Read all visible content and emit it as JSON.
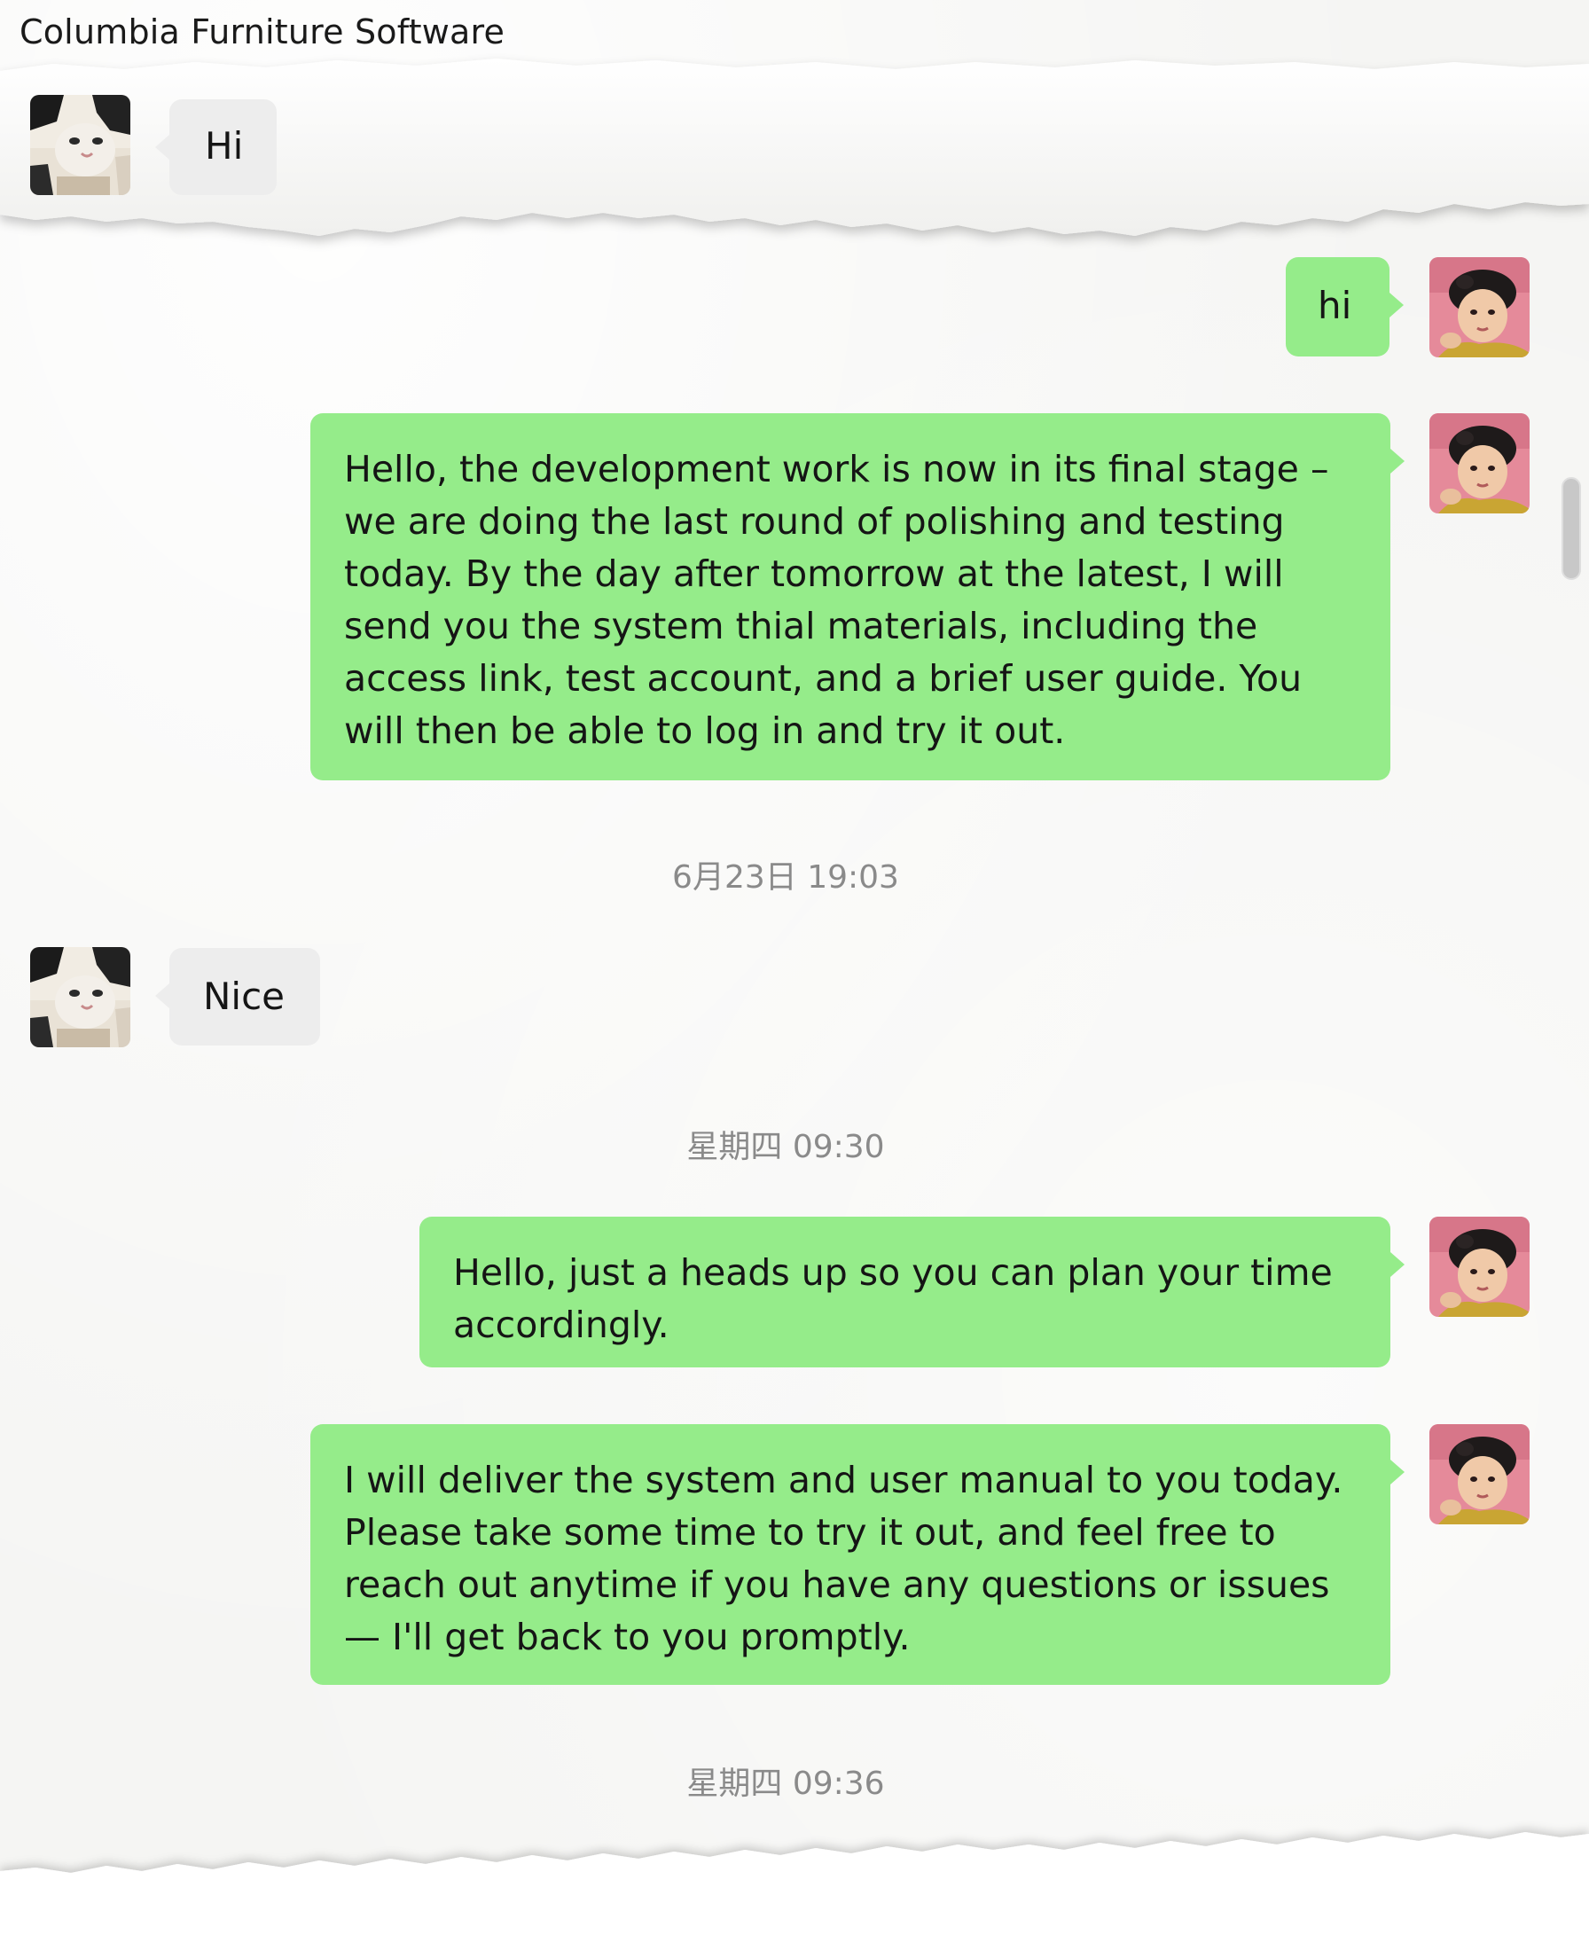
{
  "window": {
    "title": "Columbia Furniture Software"
  },
  "messages": [
    {
      "sender": "contact",
      "text": "Hi"
    },
    {
      "sender": "me",
      "text": "hi"
    },
    {
      "sender": "me",
      "text": "Hello, the development work is now in its final stage – we are doing the last round of polishing and testing today. By the day after tomorrow at the latest, I will send you the system thial materials, including the access link, test account, and a brief user guide. You will then be able to log in and try it out."
    },
    {
      "sender": "contact",
      "text": "Nice"
    },
    {
      "sender": "me",
      "text": "Hello, just a heads up so you can plan your time accordingly."
    },
    {
      "sender": "me",
      "text": "I will deliver the system and user manual to you today. Please take some time to try it out, and feel free to reach out anytime if you have any questions or issues — I'll get back to you promptly."
    }
  ],
  "timestamps": [
    "6月23日 19:03",
    "星期四 09:30",
    "星期四 09:36"
  ],
  "colors": {
    "outgoing_bubble": "#95ec8a",
    "incoming_bubble": "#ededed",
    "timestamp_text": "#8a8a8a",
    "background": "#f5f5f3"
  },
  "icons": {
    "contact_avatar": "cat-avatar-icon",
    "my_avatar": "user-avatar-icon"
  }
}
